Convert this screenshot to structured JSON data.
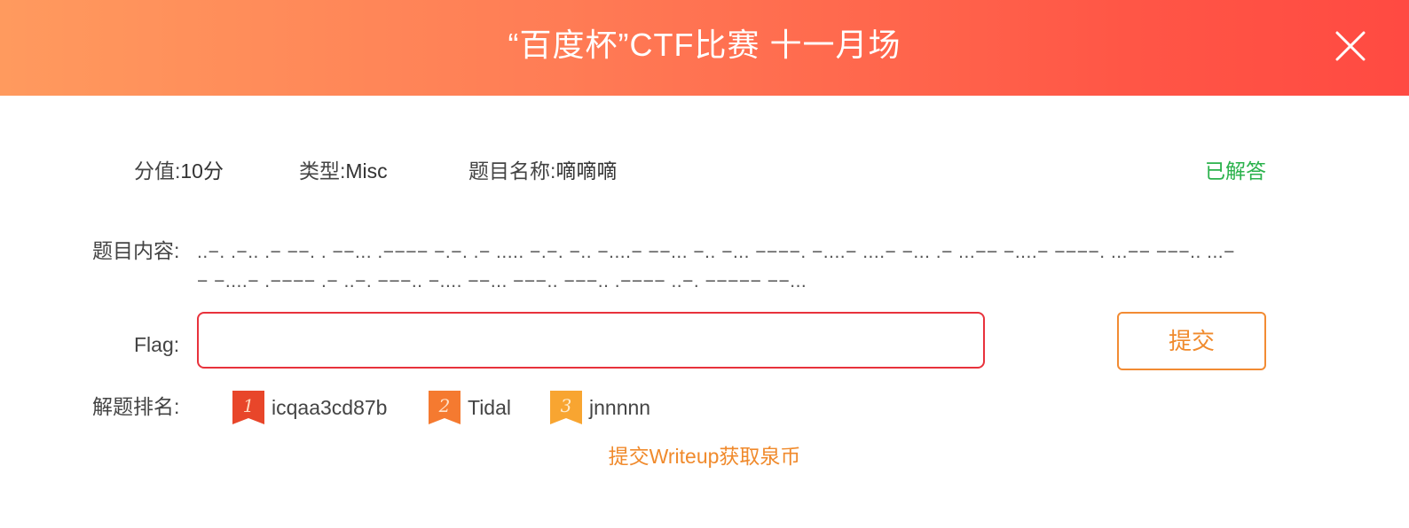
{
  "header": {
    "title": "“百度杯”CTF比赛 十一月场",
    "close_icon": "close-icon"
  },
  "problem": {
    "score_label": "分值:",
    "score_value": "10分",
    "type_label": "类型:",
    "type_value": "Misc",
    "name_label": "题目名称:",
    "name_value": "嘀嘀嘀",
    "status": "已解答",
    "content_label": "题目内容:",
    "content_text": "..−. .−.. .− −−. . −−... .−−−− −.−. .− ..... −.−. −.. −....− −−... −.. −... −−−−. −....− ....− −... .− ...−− −....− −−−−. ...−− −−−.. ...−− −....− .−−−− .− ..−. −−−.. −.... −−... −−−.. −−−.. .−−−− ..−. −−−−− −−..."
  },
  "flag": {
    "label": "Flag:",
    "value": "",
    "placeholder": "",
    "submit_label": "提交"
  },
  "ranking": {
    "label": "解题排名:",
    "entries": [
      {
        "rank": "1",
        "name": "icqaa3cd87b",
        "color": "#e8462a"
      },
      {
        "rank": "2",
        "name": "Tidal",
        "color": "#f57a30"
      },
      {
        "rank": "3",
        "name": "jnnnnn",
        "color": "#f8a531"
      }
    ]
  },
  "writeup": {
    "link_text": "提交Writeup获取泉币"
  },
  "colors": {
    "accent": "#ff5646",
    "solved": "#2bb24c",
    "orange": "#f08a2c",
    "input_border": "#e8323c"
  }
}
